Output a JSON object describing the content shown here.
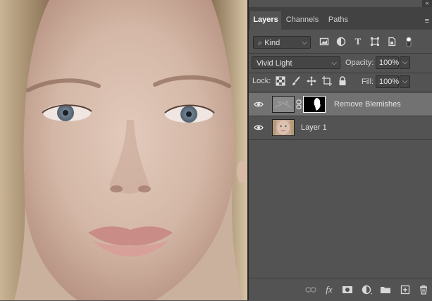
{
  "panel": {
    "collapse_glyph": "«",
    "tabs": [
      {
        "label": "Layers",
        "active": true
      },
      {
        "label": "Channels",
        "active": false
      },
      {
        "label": "Paths",
        "active": false
      }
    ],
    "menu_icon": "panel-menu-icon",
    "filter": {
      "kind_label": "Kind",
      "icons": [
        "pixel-filter-icon",
        "adjustment-filter-icon",
        "type-filter-icon",
        "shape-filter-icon",
        "smart-object-filter-icon",
        "filter-toggle-icon"
      ]
    },
    "blend": {
      "mode": "Vivid Light",
      "opacity_label": "Opacity:",
      "opacity_value": "100%"
    },
    "lock": {
      "label": "Lock:",
      "icons": [
        "lock-transparent-pixels-icon",
        "lock-image-pixels-icon",
        "lock-position-icon",
        "lock-artboard-icon",
        "lock-all-icon"
      ],
      "fill_label": "Fill:",
      "fill_value": "100%"
    },
    "layers": [
      {
        "name": "Remove Blemishes",
        "selected": true,
        "has_mask": true,
        "visible": true
      },
      {
        "name": "Layer 1",
        "selected": false,
        "has_mask": false,
        "visible": true
      }
    ],
    "bottom_icons": [
      "link-layers-icon",
      "fx-icon",
      "add-mask-icon",
      "adjustment-layer-icon",
      "new-group-icon",
      "new-layer-icon",
      "delete-layer-icon"
    ],
    "bottom_glyphs": {
      "fx": "fx"
    }
  },
  "colors": {
    "panel_bg": "#535353",
    "tab_bar_bg": "#424242",
    "selected_layer": "#727272",
    "skin": "#cfb5a3",
    "hair": "#b7a083"
  }
}
